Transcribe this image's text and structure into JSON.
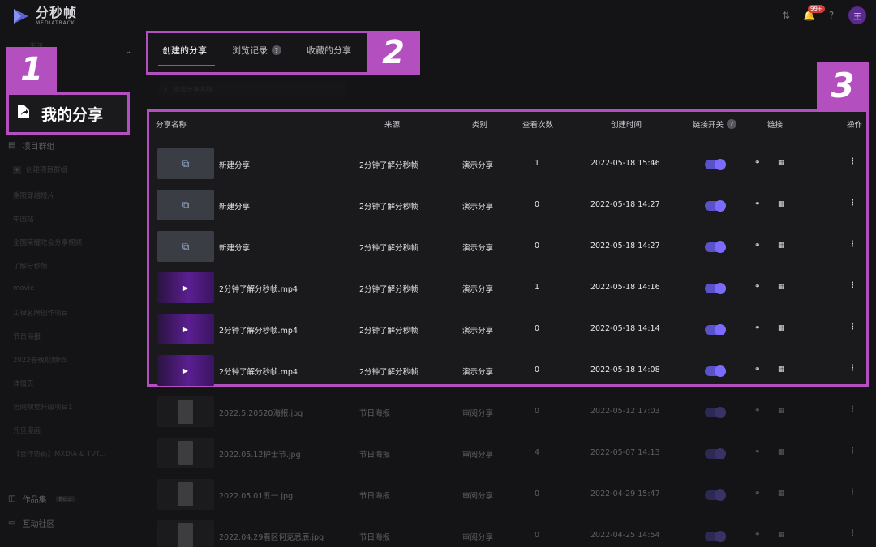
{
  "app": {
    "logo_cn": "分秒帧",
    "logo_en": "MEDIATRACK",
    "notification_badge": "99+",
    "avatar_initial": "王"
  },
  "sidebar": {
    "team_name": "王王",
    "my_share": "我的分享",
    "project_group": "项目群组",
    "create_group": "创建项目群组",
    "projects": [
      "重阳穿越短片",
      "中国站",
      "全国荣耀吃会分享视频",
      "了解分秒帧",
      "movie",
      "工律名牌创作项目",
      "节日海报",
      "2022春晚视频h5",
      "详情页",
      "官网视觉升级项目1",
      "元旦漫画",
      "【合作协商】MXDIA & TVT..."
    ],
    "portfolio": "作品集",
    "portfolio_badge": "Beta",
    "community": "互动社区"
  },
  "callouts": {
    "one": "1",
    "two": "2",
    "three": "3"
  },
  "tabs": [
    {
      "label": "创建的分享"
    },
    {
      "label": "浏览记录"
    },
    {
      "label": "收藏的分享"
    }
  ],
  "search": {
    "placeholder": "搜索分享名称"
  },
  "table": {
    "headers": {
      "name": "分享名称",
      "source": "来源",
      "type": "类别",
      "views": "查看次数",
      "created": "创建时间",
      "link_switch": "链接开关",
      "link": "链接",
      "actions": "操作"
    },
    "rows": [
      {
        "thumb": "doc",
        "name": "新建分享",
        "source": "2分钟了解分秒帧",
        "type": "演示分享",
        "views": "1",
        "created": "2022-05-18 15:46"
      },
      {
        "thumb": "doc",
        "name": "新建分享",
        "source": "2分钟了解分秒帧",
        "type": "演示分享",
        "views": "0",
        "created": "2022-05-18 14:27"
      },
      {
        "thumb": "doc",
        "name": "新建分享",
        "source": "2分钟了解分秒帧",
        "type": "演示分享",
        "views": "0",
        "created": "2022-05-18 14:27"
      },
      {
        "thumb": "vid",
        "name": "2分钟了解分秒帧.mp4",
        "source": "2分钟了解分秒帧",
        "type": "演示分享",
        "views": "1",
        "created": "2022-05-18 14:16"
      },
      {
        "thumb": "vid",
        "name": "2分钟了解分秒帧.mp4",
        "source": "2分钟了解分秒帧",
        "type": "演示分享",
        "views": "0",
        "created": "2022-05-18 14:14"
      },
      {
        "thumb": "vid",
        "name": "2分钟了解分秒帧.mp4",
        "source": "2分钟了解分秒帧",
        "type": "演示分享",
        "views": "0",
        "created": "2022-05-18 14:08"
      },
      {
        "thumb": "img",
        "name": "2022.5.20520海报.jpg",
        "source": "节日海报",
        "type": "审阅分享",
        "views": "0",
        "created": "2022-05-12 17:03"
      },
      {
        "thumb": "img",
        "name": "2022.05.12护士节.jpg",
        "source": "节日海报",
        "type": "审阅分享",
        "views": "4",
        "created": "2022-05-07 14:13"
      },
      {
        "thumb": "img",
        "name": "2022.05.01五一.jpg",
        "source": "节日海报",
        "type": "审阅分享",
        "views": "0",
        "created": "2022-04-29 15:47"
      },
      {
        "thumb": "img",
        "name": "2022.04.29看区何克忌辰.jpg",
        "source": "节日海报",
        "type": "审阅分享",
        "views": "0",
        "created": "2022-04-25 14:54"
      }
    ]
  }
}
